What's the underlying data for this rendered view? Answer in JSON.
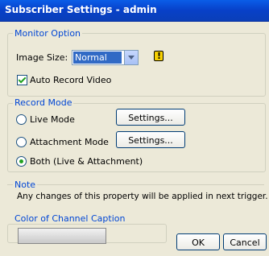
{
  "window": {
    "title": "Subscriber Settings - admin"
  },
  "monitor": {
    "legend": "Monitor Option",
    "image_size_label": "Image Size:",
    "image_size_value": "Normal",
    "auto_record_label": "Auto Record Video",
    "auto_record_checked": true
  },
  "record_mode": {
    "legend": "Record Mode",
    "live_label": "Live Mode",
    "attachment_label": "Attachment Mode",
    "both_label": "Both (Live & Attachment)",
    "settings_label": "Settings...",
    "selected": "both"
  },
  "note": {
    "legend": "Note",
    "text": "Any changes of this property will be applied in next trigger."
  },
  "caption_color": {
    "legend": "Color of Channel Caption"
  },
  "buttons": {
    "ok": "OK",
    "cancel": "Cancel"
  }
}
